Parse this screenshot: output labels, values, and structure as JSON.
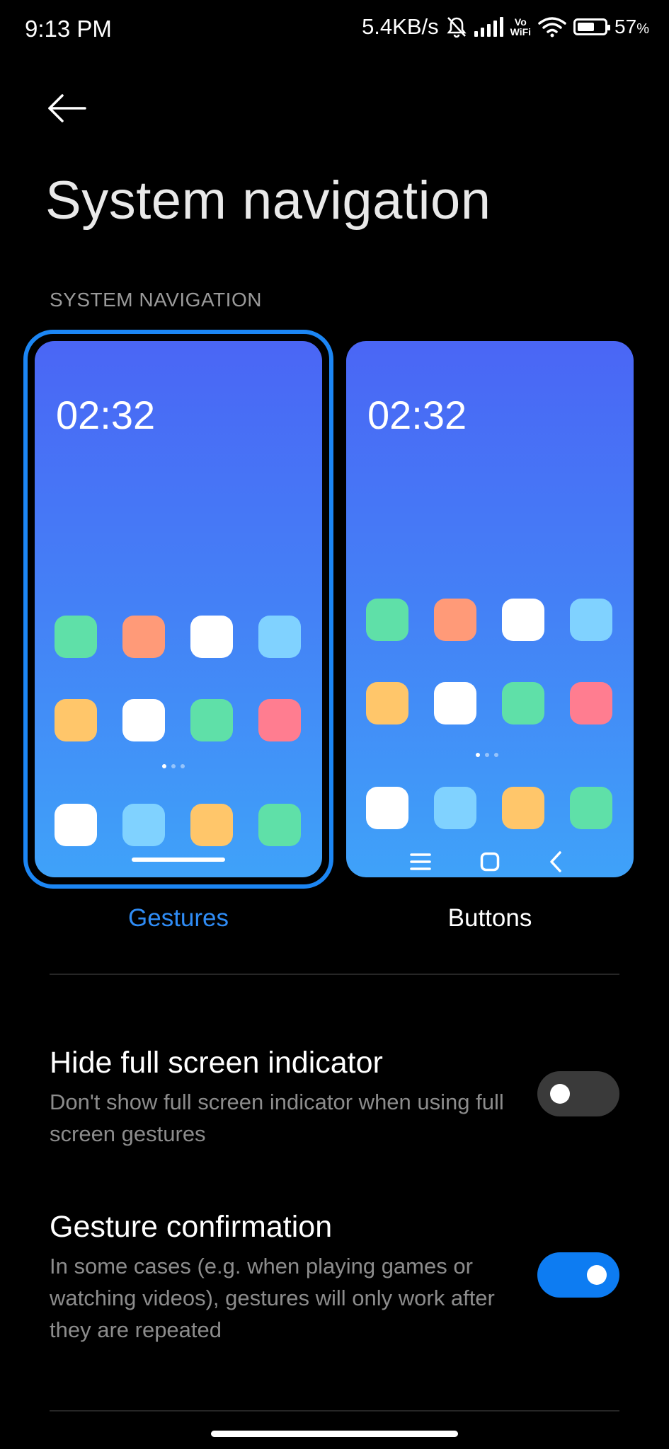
{
  "status": {
    "time": "9:13 PM",
    "speed": "5.4KB/s",
    "vowifi_top": "Vo",
    "vowifi_bottom": "WiFi",
    "battery_pct": "57",
    "battery_unit": "%"
  },
  "header": {
    "title": "System navigation",
    "section": "SYSTEM NAVIGATION"
  },
  "previews": {
    "gestures": {
      "clock": "02:32",
      "label": "Gestures",
      "selected": true
    },
    "buttons": {
      "clock": "02:32",
      "label": "Buttons",
      "selected": false
    }
  },
  "app_colors": {
    "gestures": [
      "#5fe0a8",
      "#ff9a78",
      "#ffffff",
      "#80d2ff",
      "#ffc66a",
      "#ffffff",
      "#5fe0a8",
      "#ff7d90",
      "#ffffff",
      "#80d2ff",
      "#ffc66a",
      "#5fe0a8"
    ],
    "buttons": [
      "#5fe0a8",
      "#ff9a78",
      "#ffffff",
      "#80d2ff",
      "#ffc66a",
      "#ffffff",
      "#5fe0a8",
      "#ff7d90",
      "#ffffff",
      "#80d2ff",
      "#ffc66a",
      "#5fe0a8"
    ]
  },
  "settings": [
    {
      "name": "Hide full screen indicator",
      "desc": "Don't show full screen indicator when using full screen gestures",
      "enabled": false
    },
    {
      "name": "Gesture confirmation",
      "desc": "In some cases (e.g. when playing games or watching videos), gestures will only work after they are repeated",
      "enabled": true
    }
  ],
  "colors": {
    "accent": "#1c86f4",
    "toggle_on": "#0d7cf2",
    "toggle_off": "#3a3a3a"
  }
}
